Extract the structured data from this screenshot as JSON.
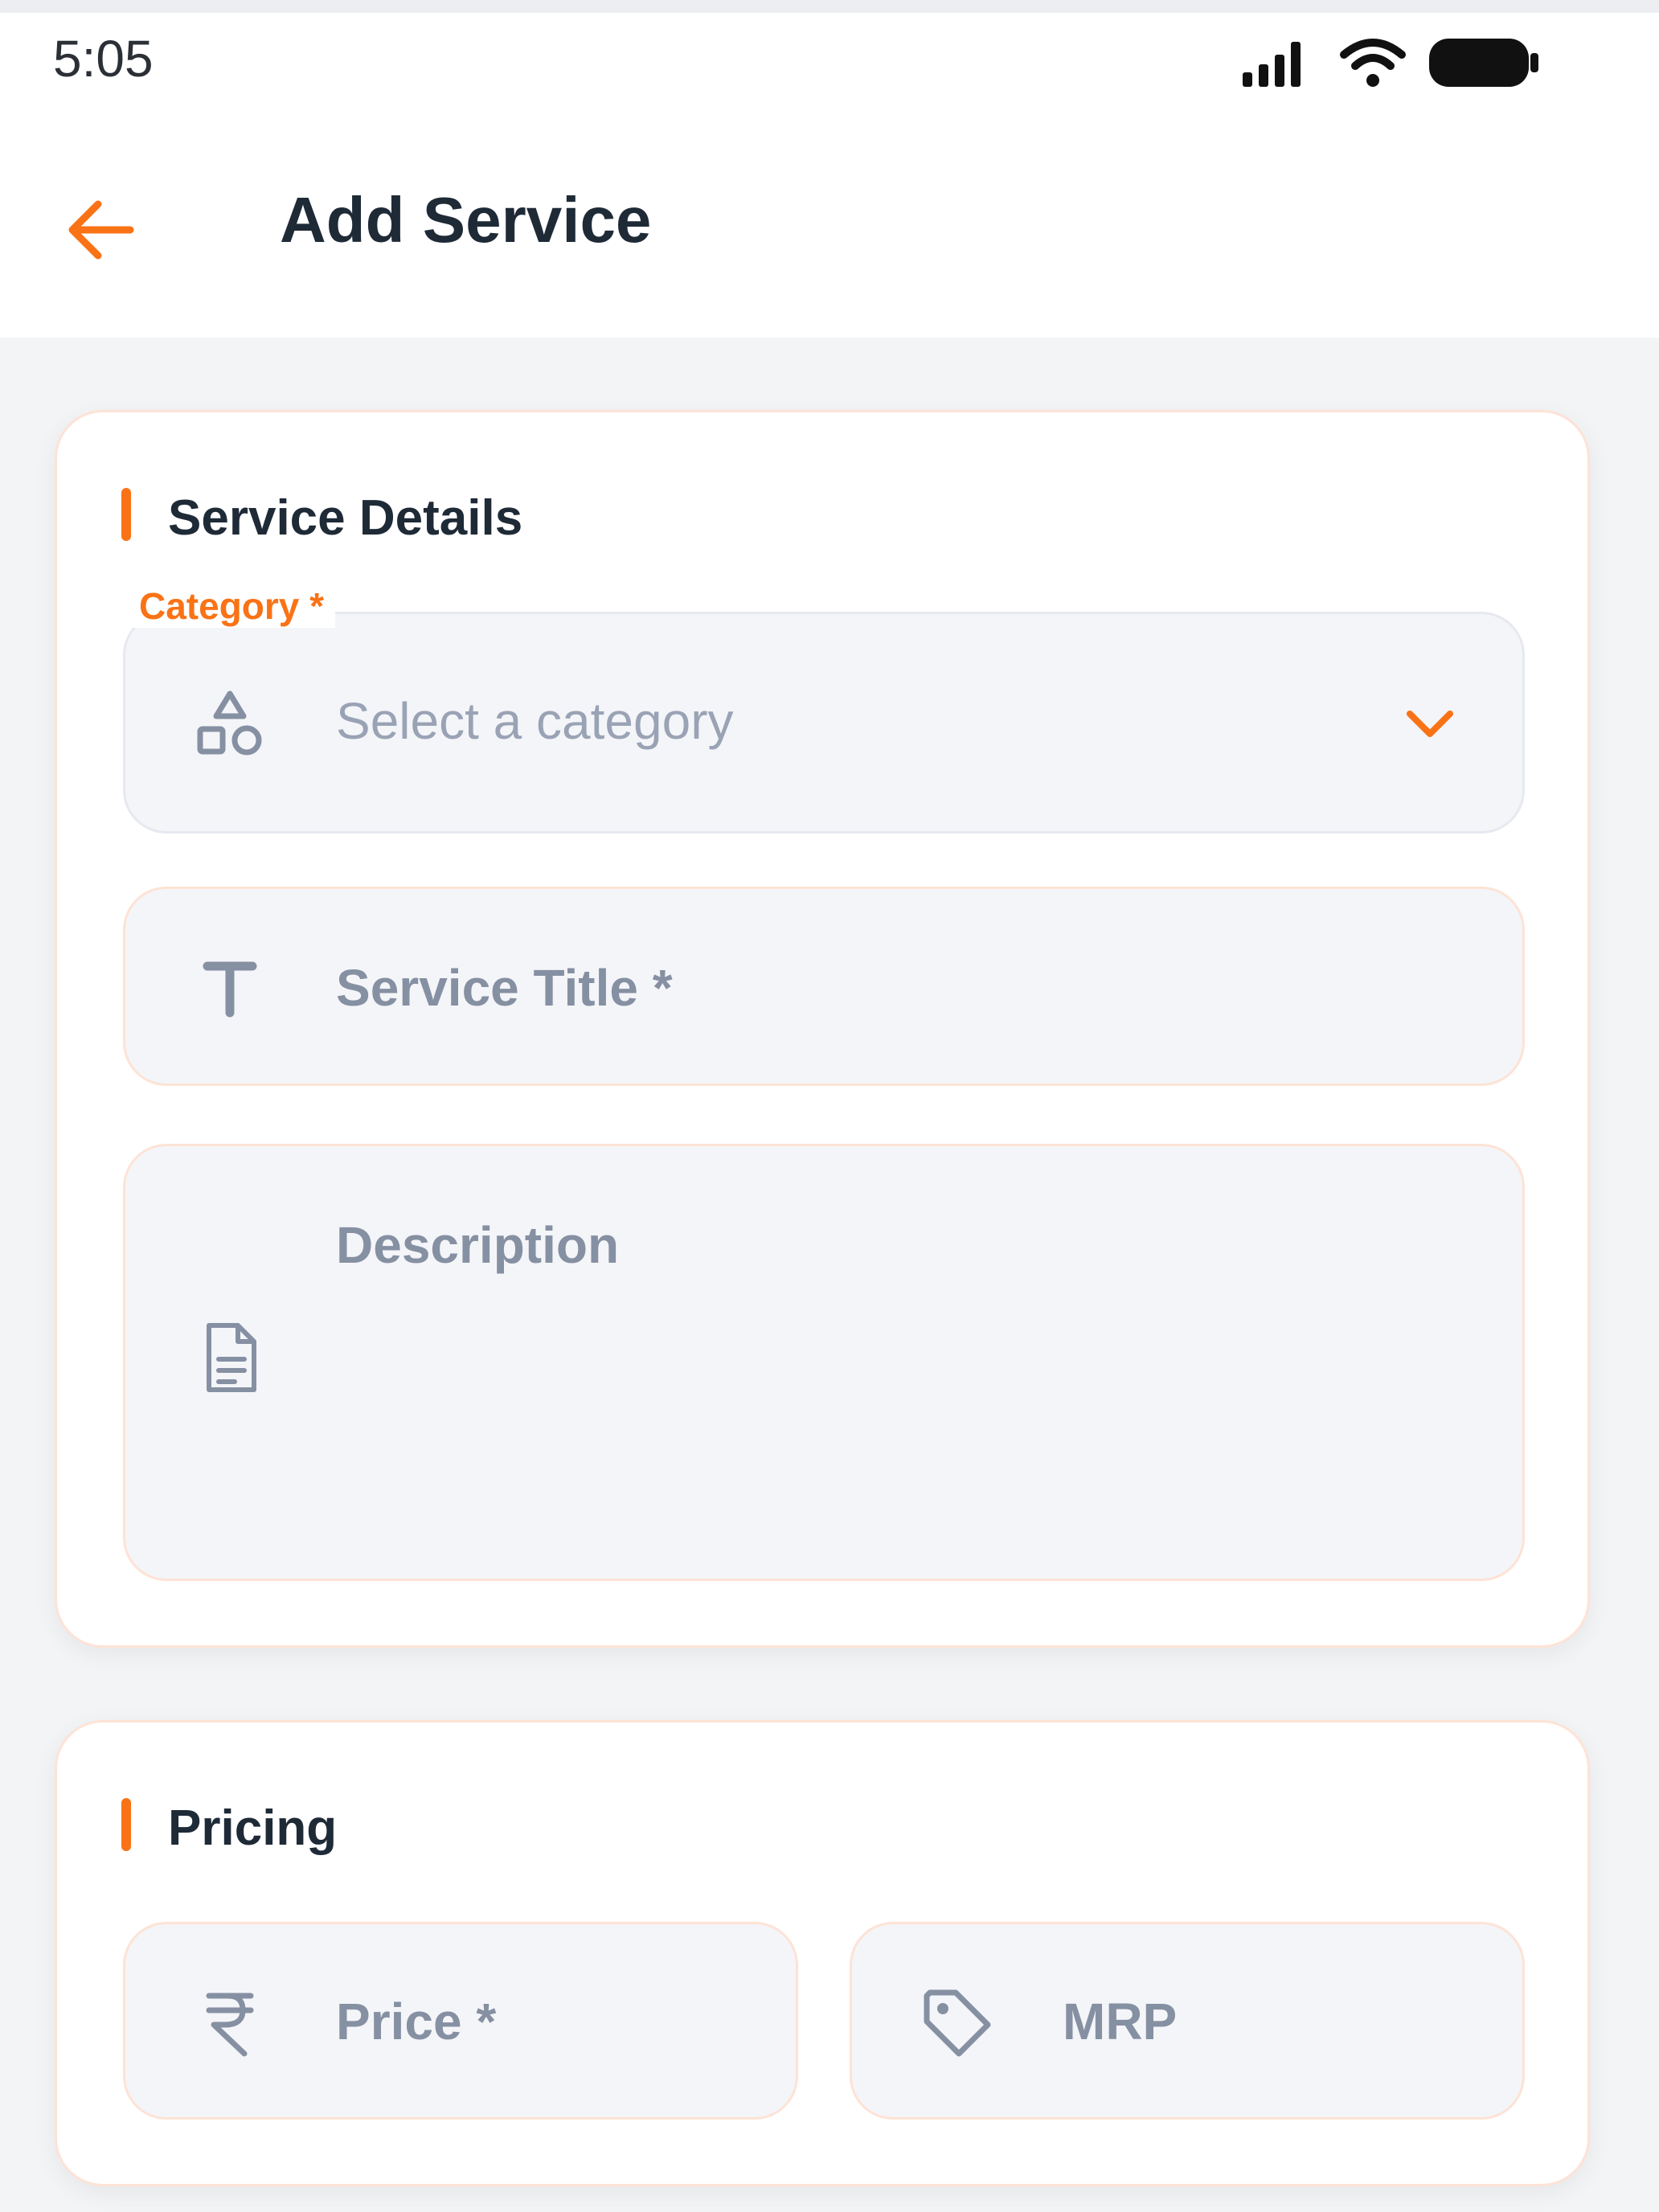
{
  "status_bar": {
    "time": "5:05",
    "icons": [
      "signal-icon",
      "wifi-icon",
      "battery-icon"
    ]
  },
  "app_bar": {
    "title": "Add Service",
    "back_icon": "arrow-left-icon",
    "accent_color": "#f97316"
  },
  "service_details": {
    "heading": "Service Details",
    "category": {
      "label": "Category *",
      "placeholder": "Select a category",
      "icon": "shapes-icon",
      "dropdown_icon": "chevron-down-icon"
    },
    "title_field": {
      "placeholder": "Service Title *",
      "icon": "text-t-icon"
    },
    "description_field": {
      "placeholder": "Description",
      "icon": "document-icon"
    }
  },
  "pricing": {
    "heading": "Pricing",
    "price_field": {
      "placeholder": "Price *",
      "icon": "rupee-icon"
    },
    "mrp_field": {
      "placeholder": "MRP",
      "icon": "tag-icon"
    }
  }
}
